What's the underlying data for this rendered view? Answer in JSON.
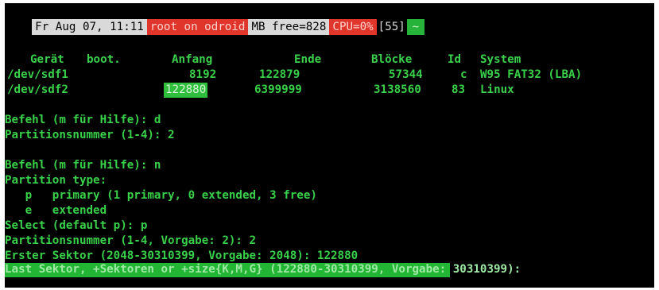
{
  "status_bar": {
    "date": "Fr Aug 07, 11:11",
    "host": "root on odroid",
    "mem": "MB free=828",
    "cpu": "CPU=0%",
    "window": "[55]",
    "tilde": "~"
  },
  "table": {
    "headers": {
      "device": "Gerät",
      "boot": "boot.",
      "start": "Anfang",
      "end": "Ende",
      "blocks": "Blöcke",
      "id": "Id",
      "system": "System"
    },
    "rows": [
      {
        "device": "/dev/sdf1",
        "start": "8192",
        "end": "122879",
        "blocks": "57344",
        "id": "c",
        "system": "W95 FAT32 (LBA)"
      },
      {
        "device": "/dev/sdf2",
        "start": "122880",
        "end": "6399999",
        "blocks": "3138560",
        "id": "83",
        "system": "Linux"
      }
    ]
  },
  "lines": {
    "cmd1": "Befehl (m für Hilfe): d",
    "partnum1": "Partitionsnummer (1-4): 2",
    "cmd2": "Befehl (m für Hilfe): n",
    "ptype": "Partition type:",
    "opt_p": "   p   primary (1 primary, 0 extended, 3 free)",
    "opt_e": "   e   extended",
    "select": "Select (default p): p",
    "partnum2": "Partitionsnummer (1-4, Vorgabe: 2): 2",
    "first_sector": "Erster Sektor (2048-30310399, Vorgabe: 2048): 122880",
    "last_sector": "Last Sektor, +Sektoren or +size{K,M,G} (122880-30310399, Vorgabe: 30310399):"
  },
  "colors": {
    "terminal_bg": "#000000",
    "terminal_text": "#39d04a",
    "status_red": "#e0352b",
    "status_gray": "#d9d9d9",
    "highlight_green": "#23b534"
  }
}
